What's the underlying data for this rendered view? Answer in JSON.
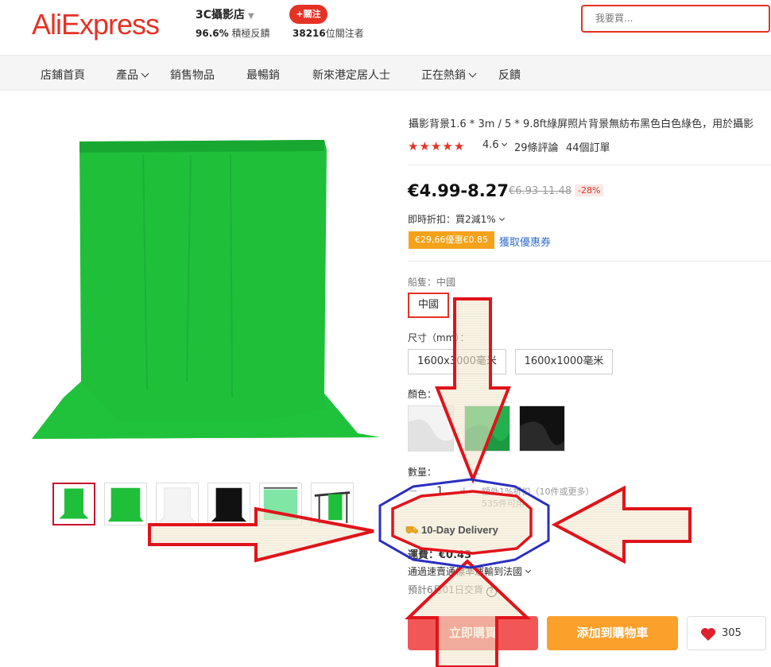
{
  "header": {
    "logo": "AliExpress",
    "store_name": "3C攝影店",
    "positive_rate": "96.6%",
    "positive_label": "積極反饋",
    "follow_label": "+關注",
    "followers_count": "38216",
    "followers_label": "位關注者",
    "search_placeholder": "我要買..."
  },
  "nav": {
    "items": [
      {
        "label": "店鋪首頁"
      },
      {
        "label": "產品"
      },
      {
        "label": "銷售物品"
      },
      {
        "label": "最暢銷"
      },
      {
        "label": "新來港定居人士"
      },
      {
        "label": "正在熱銷"
      },
      {
        "label": "反饋"
      }
    ]
  },
  "product": {
    "title": "攝影背景1.6 * 3m / 5 * 9.8ft綠屏照片背景無紡布黑色白色綠色，用於攝影",
    "rating": "4.6",
    "reviews": "29條評論",
    "orders": "44個訂單",
    "price": "€4.99-8.27",
    "old_price": "€6.93-11.48",
    "discount": "-28%",
    "instant_discount": "即時折扣：買2減1%",
    "coupon": "€29,66優惠€0.85",
    "coupon_link": "獲取優惠券",
    "ships_from_label": "船隻：中國",
    "ships_from_option": "中國",
    "size_label": "尺寸（mm）：",
    "size_options": [
      "1600x3000毫米",
      "1600x1000毫米"
    ],
    "color_label": "顏色：",
    "quantity_label": "數量：",
    "quantity_value": "1",
    "bulk_hint": "額外1%折扣（10件或更多）",
    "bulk_available": "535件可用",
    "delivery_badge": "10-Day Delivery",
    "shipping": "運費：€0.43",
    "ship_method": "通過速賣通標準運輸到法國",
    "eta": "預計6月01日交貨",
    "buy_label": "立即購買",
    "cart_label": "添加到購物車",
    "wish_count": "305"
  },
  "colors": {
    "accent": "#e43225",
    "buy": "#f25757",
    "cart": "#fba02b",
    "coupon": "#f4a21a",
    "annotation_red": "#e0141b",
    "annotation_blue": "#2b2fc0",
    "backdrop_green": "#1fbf3a"
  }
}
